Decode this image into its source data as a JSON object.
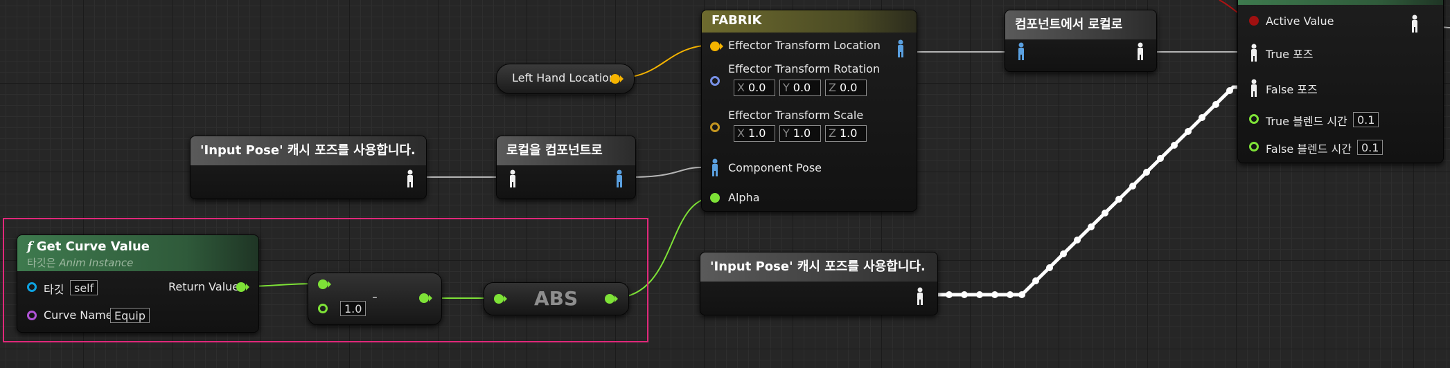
{
  "nodes": {
    "fabrik": {
      "title": "FABRIK",
      "pins": {
        "effector_location": "Effector Transform Location",
        "effector_rotation": "Effector Transform Rotation",
        "effector_scale": "Effector Transform Scale",
        "component_pose": "Component Pose",
        "alpha": "Alpha"
      },
      "rotation": {
        "x_axis": "X",
        "x": "0.0",
        "y_axis": "Y",
        "y": "0.0",
        "z_axis": "Z",
        "z": "0.0"
      },
      "scale": {
        "x_axis": "X",
        "x": "1.0",
        "y_axis": "Y",
        "y": "1.0",
        "z_axis": "Z",
        "z": "1.0"
      }
    },
    "component_to_local": {
      "title": "컴포넌트에서 로컬로"
    },
    "local_to_component": {
      "title": "로컬을 컴포넌트로"
    },
    "left_hand_location": {
      "title": "Left Hand Location"
    },
    "cached_pose_1": {
      "title": "'Input Pose' 캐시 포즈를 사용합니다."
    },
    "cached_pose_2": {
      "title": "'Input Pose' 캐시 포즈를 사용합니다."
    },
    "blend": {
      "active_value": "Active Value",
      "true_pose": "True 포즈",
      "false_pose": "False 포즈",
      "true_blend_time": "True 블렌드 시간",
      "true_blend_value": "0.1",
      "false_blend_time": "False 블렌드 시간",
      "false_blend_value": "0.1"
    },
    "get_curve_value": {
      "title": "Get Curve Value",
      "func_icon": "f",
      "subtitle_prefix": "타깃은",
      "subtitle_class": "Anim Instance",
      "target_label": "타깃",
      "target_value": "self",
      "return_label": "Return Value",
      "curve_name_label": "Curve Name",
      "curve_name_value": "Equip"
    },
    "subtract": {
      "input_value": "1.0",
      "operator": "-"
    },
    "abs": {
      "title": "ABS"
    }
  },
  "colors": {
    "selection": "#e0287a",
    "exec_wire": "#ffffff",
    "float_wire": "#7ee237",
    "vector_wire": "#f6b400",
    "pose_wire": "#c8c8c8"
  },
  "icons": [
    "function-icon",
    "pose-icon",
    "pin-icon"
  ]
}
